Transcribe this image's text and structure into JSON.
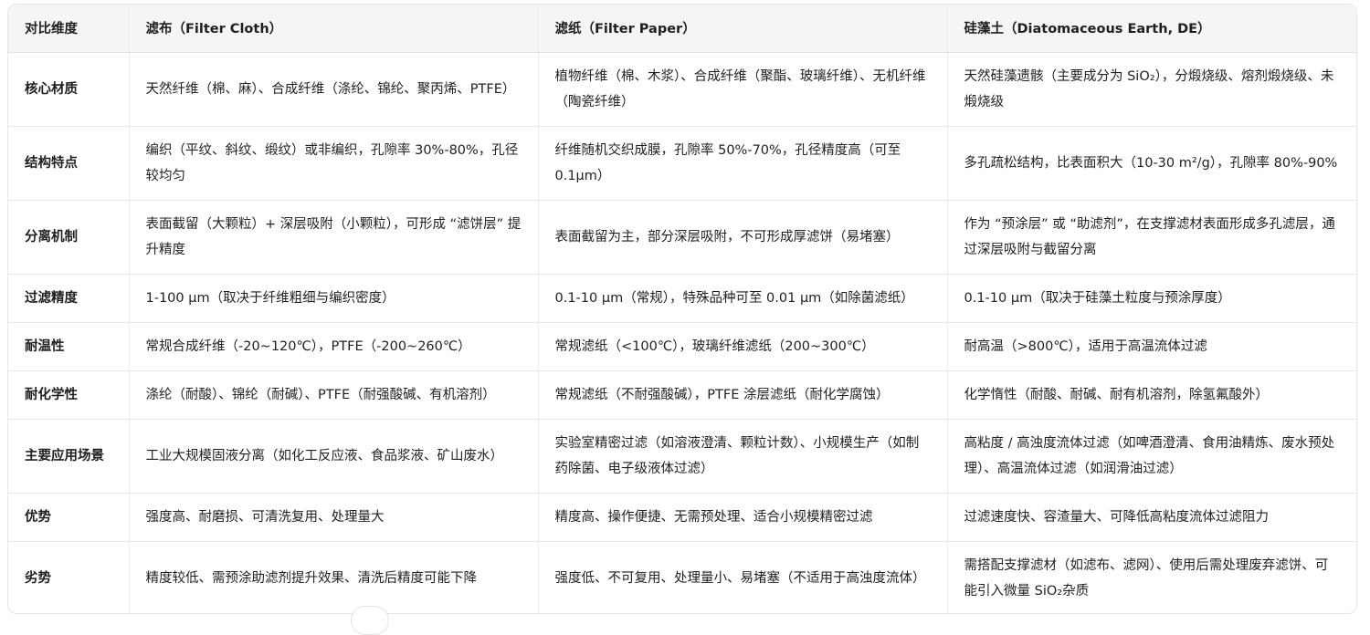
{
  "table": {
    "headers": [
      "对比维度",
      "滤布（Filter Cloth）",
      "滤纸（Filter Paper）",
      "硅藻土（Diatomaceous Earth, DE）"
    ],
    "rows": [
      [
        "核心材质",
        "天然纤维（棉、麻）、合成纤维（涤纶、锦纶、聚丙烯、PTFE）",
        "植物纤维（棉、木浆）、合成纤维（聚酯、玻璃纤维）、无机纤维（陶瓷纤维）",
        "天然硅藻遗骸（主要成分为 SiO₂），分煅烧级、熔剂煅烧级、未煅烧级"
      ],
      [
        "结构特点",
        "编织（平纹、斜纹、缎纹）或非编织，孔隙率 30%-80%，孔径较均匀",
        "纤维随机交织成膜，孔隙率 50%-70%，孔径精度高（可至 0.1μm）",
        "多孔疏松结构，比表面积大（10-30 m²/g），孔隙率 80%-90%"
      ],
      [
        "分离机制",
        "表面截留（大颗粒）+ 深层吸附（小颗粒），可形成 “滤饼层” 提升精度",
        "表面截留为主，部分深层吸附，不可形成厚滤饼（易堵塞）",
        "作为 “预涂层” 或 “助滤剂”，在支撑滤材表面形成多孔滤层，通过深层吸附与截留分离"
      ],
      [
        "过滤精度",
        "1-100 μm（取决于纤维粗细与编织密度）",
        "0.1-10 μm（常规），特殊品种可至 0.01 μm（如除菌滤纸）",
        "0.1-10 μm（取决于硅藻土粒度与预涂厚度）"
      ],
      [
        "耐温性",
        "常规合成纤维（-20~120℃），PTFE（-200~260℃）",
        "常规滤纸（<100℃），玻璃纤维滤纸（200~300℃）",
        "耐高温（>800℃），适用于高温流体过滤"
      ],
      [
        "耐化学性",
        "涤纶（耐酸）、锦纶（耐碱）、PTFE（耐强酸碱、有机溶剂）",
        "常规滤纸（不耐强酸碱），PTFE 涂层滤纸（耐化学腐蚀）",
        "化学惰性（耐酸、耐碱、耐有机溶剂，除氢氟酸外）"
      ],
      [
        "主要应用场景",
        "工业大规模固液分离（如化工反应液、食品浆液、矿山废水）",
        "实验室精密过滤（如溶液澄清、颗粒计数）、小规模生产（如制药除菌、电子级液体过滤）",
        "高粘度 / 高浊度流体过滤（如啤酒澄清、食用油精炼、废水预处理）、高温流体过滤（如润滑油过滤）"
      ],
      [
        "优势",
        "强度高、耐磨损、可清洗复用、处理量大",
        "精度高、操作便捷、无需预处理、适合小规模精密过滤",
        "过滤速度快、容渣量大、可降低高粘度流体过滤阻力"
      ],
      [
        "劣势",
        "精度较低、需预涂助滤剂提升效果、清洗后精度可能下降",
        "强度低、不可复用、处理量小、易堵塞（不适用于高浊度流体）",
        "需搭配支撑滤材（如滤布、滤网）、使用后需处理废弃滤饼、可能引入微量 SiO₂杂质"
      ]
    ]
  }
}
